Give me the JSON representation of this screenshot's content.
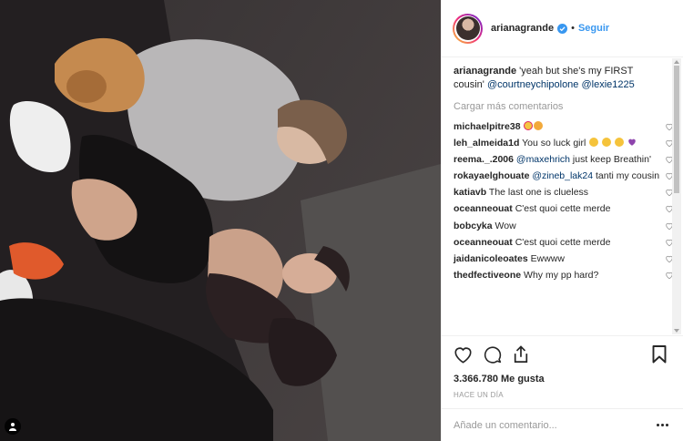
{
  "post": {
    "username": "arianagrande",
    "follow_label": "Seguir",
    "separator": "•"
  },
  "caption": {
    "username": "arianagrande",
    "text": "'yeah but she's my FIRST cousin'",
    "mention1": "@courtneychipolone",
    "mention2": "@lexie1225"
  },
  "load_more": "Cargar más comentarios",
  "comments": [
    {
      "user": "michaelpitre38",
      "text": ""
    },
    {
      "user": "leh_almeida1d",
      "text": "You so luck girl"
    },
    {
      "user": "reema._.2006",
      "mention": "@maxehrich",
      "text": "just keep Breathin'"
    },
    {
      "user": "rokayaelghouate",
      "mention": "@zineb_lak24",
      "text": "tanti my cousin"
    },
    {
      "user": "katiavb",
      "text": "The last one is clueless"
    },
    {
      "user": "oceanneouat",
      "text": "C'est quoi cette merde"
    },
    {
      "user": "bobcyka",
      "text": "Wow"
    },
    {
      "user": "oceanneouat",
      "text": "C'est quoi cette merde"
    },
    {
      "user": "jaidanicoleoates",
      "text": "Ewwww"
    },
    {
      "user": "thedfectiveone",
      "text": "Why my pp hard?"
    }
  ],
  "likes": "3.366.780 Me gusta",
  "time": "HACE UN DÍA",
  "add_comment": {
    "placeholder": "Añade un comentario..."
  },
  "colors": {
    "link": "#3897f0",
    "mention": "#003569",
    "verified": "#3897f0"
  }
}
